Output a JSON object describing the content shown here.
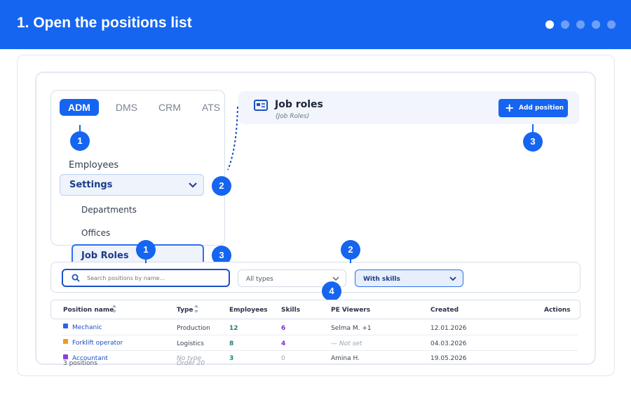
{
  "header": {
    "title": "1. Open the positions list",
    "step_count": 5,
    "active_step": 1
  },
  "nav": {
    "tabs": [
      "ADM",
      "DMS",
      "CRM",
      "ATS"
    ],
    "active_tab": "ADM",
    "employees": "Employees",
    "settings": "Settings",
    "departments": "Departments",
    "offices": "Offices",
    "job_roles": "Job Roles"
  },
  "roles_header": {
    "title": "Job roles",
    "subtitle": "(Job Roles)",
    "add_button": "Add position"
  },
  "callouts": {
    "a1": "1",
    "a2": "2",
    "a3": "3",
    "b1": "1",
    "b2": "2",
    "b3": "3",
    "b4": "4"
  },
  "filters": {
    "search_placeholder": "Search positions by name...",
    "type_value": "All types",
    "skills_value": "With skills"
  },
  "table": {
    "columns": {
      "name": "Position name",
      "type": "Type",
      "employees": "Employees",
      "skills": "Skills",
      "viewers": "PE Viewers",
      "created": "Created",
      "actions": "Actions"
    },
    "rows": [
      {
        "name": "Mechanic",
        "type": "Production",
        "employees": "12",
        "skills": "6",
        "viewers": "Selma M. +1",
        "created": "12.01.2026",
        "color": "#2a62e8"
      },
      {
        "name": "Forklift operator",
        "type": "Logistics",
        "employees": "8",
        "skills": "4",
        "viewers": "— Not set",
        "created": "04.03.2026",
        "color": "#f29a1d"
      },
      {
        "name": "Accountant",
        "type": "No type",
        "employees": "3",
        "skills": "0",
        "viewers": "Amina H.",
        "created": "19.05.2026",
        "color": "#8a3ee0"
      }
    ],
    "footer_count": "3 positions",
    "footer_order": "Order 20"
  }
}
